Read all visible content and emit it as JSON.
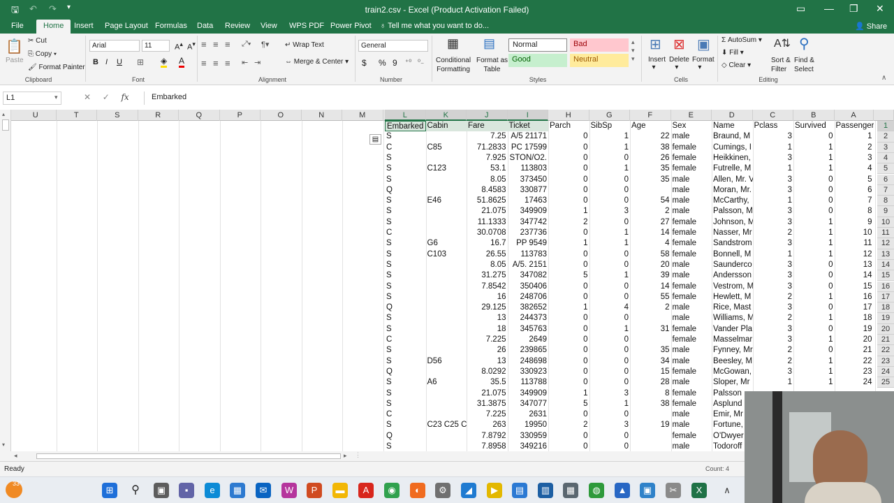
{
  "window": {
    "title": "train2.csv - Excel (Product Activation Failed)"
  },
  "ribbon_tabs": [
    "File",
    "Home",
    "Insert",
    "Page Layout",
    "Formulas",
    "Data",
    "Review",
    "View",
    "WPS PDF",
    "Power Pivot"
  ],
  "tell_me": "Tell me what you want to do...",
  "share": "Share",
  "clipboard": {
    "paste": "Paste",
    "cut": "Cut",
    "copy": "Copy",
    "format_painter": "Format Painter",
    "label": "Clipboard"
  },
  "font": {
    "name": "Arial",
    "size": "11",
    "label": "Font"
  },
  "alignment": {
    "wrap": "Wrap Text",
    "merge": "Merge & Center",
    "label": "Alignment"
  },
  "number": {
    "format": "General",
    "label": "Number",
    "currency": "$",
    "percent": "%",
    "comma": "9"
  },
  "styles": {
    "cond": "Conditional\nFormatting",
    "table": "Format as\nTable",
    "label": "Styles",
    "normal": "Normal",
    "bad": "Bad",
    "good": "Good",
    "neutral": "Neutral"
  },
  "cells": {
    "insert": "Insert",
    "delete": "Delete",
    "format": "Format",
    "label": "Cells"
  },
  "editing": {
    "autosum": "AutoSum",
    "fill": "Fill",
    "clear": "Clear",
    "sort": "Sort &\nFilter",
    "find": "Find &\nSelect",
    "label": "Editing"
  },
  "formula_bar": {
    "name_box": "L1",
    "fx": "fx",
    "content": "Embarked"
  },
  "columns_left": [
    "U",
    "T",
    "S",
    "R",
    "Q",
    "P",
    "O",
    "N",
    "M"
  ],
  "columns_data": [
    "L",
    "K",
    "J",
    "I",
    "H",
    "G",
    "F",
    "E",
    "D",
    "C",
    "B",
    "A"
  ],
  "headers": [
    "Embarked",
    "Cabin",
    "Fare",
    "Ticket",
    "Parch",
    "SibSp",
    "Age",
    "Sex",
    "Name",
    "Pclass",
    "Survived",
    "Passenger"
  ],
  "rows": [
    [
      "S",
      "",
      "7.25",
      "A/5 21171",
      "0",
      "1",
      "22",
      "male",
      "Braund, M",
      "3",
      "0",
      "1"
    ],
    [
      "C",
      "C85",
      "71.2833",
      "PC 17599",
      "0",
      "1",
      "38",
      "female",
      "Cumings, I",
      "1",
      "1",
      "2"
    ],
    [
      "S",
      "",
      "7.925",
      "STON/O2.",
      "0",
      "0",
      "26",
      "female",
      "Heikkinen,",
      "3",
      "1",
      "3"
    ],
    [
      "S",
      "C123",
      "53.1",
      "113803",
      "0",
      "1",
      "35",
      "female",
      "Futrelle, M",
      "1",
      "1",
      "4"
    ],
    [
      "S",
      "",
      "8.05",
      "373450",
      "0",
      "0",
      "35",
      "male",
      "Allen, Mr. V",
      "3",
      "0",
      "5"
    ],
    [
      "Q",
      "",
      "8.4583",
      "330877",
      "0",
      "0",
      "",
      "male",
      "Moran, Mr.",
      "3",
      "0",
      "6"
    ],
    [
      "S",
      "E46",
      "51.8625",
      "17463",
      "0",
      "0",
      "54",
      "male",
      "McCarthy,",
      "1",
      "0",
      "7"
    ],
    [
      "S",
      "",
      "21.075",
      "349909",
      "1",
      "3",
      "2",
      "male",
      "Palsson, M",
      "3",
      "0",
      "8"
    ],
    [
      "S",
      "",
      "11.1333",
      "347742",
      "2",
      "0",
      "27",
      "female",
      "Johnson, M",
      "3",
      "1",
      "9"
    ],
    [
      "C",
      "",
      "30.0708",
      "237736",
      "0",
      "1",
      "14",
      "female",
      "Nasser, Mr",
      "2",
      "1",
      "10"
    ],
    [
      "S",
      "G6",
      "16.7",
      "PP 9549",
      "1",
      "1",
      "4",
      "female",
      "Sandstrom",
      "3",
      "1",
      "11"
    ],
    [
      "S",
      "C103",
      "26.55",
      "113783",
      "0",
      "0",
      "58",
      "female",
      "Bonnell, M",
      "1",
      "1",
      "12"
    ],
    [
      "S",
      "",
      "8.05",
      "A/5. 2151",
      "0",
      "0",
      "20",
      "male",
      "Saunderco",
      "3",
      "0",
      "13"
    ],
    [
      "S",
      "",
      "31.275",
      "347082",
      "5",
      "1",
      "39",
      "male",
      "Andersson",
      "3",
      "0",
      "14"
    ],
    [
      "S",
      "",
      "7.8542",
      "350406",
      "0",
      "0",
      "14",
      "female",
      "Vestrom, M",
      "3",
      "0",
      "15"
    ],
    [
      "S",
      "",
      "16",
      "248706",
      "0",
      "0",
      "55",
      "female",
      "Hewlett, M",
      "2",
      "1",
      "16"
    ],
    [
      "Q",
      "",
      "29.125",
      "382652",
      "1",
      "4",
      "2",
      "male",
      "Rice, Mast",
      "3",
      "0",
      "17"
    ],
    [
      "S",
      "",
      "13",
      "244373",
      "0",
      "0",
      "",
      "male",
      "Williams, M",
      "2",
      "1",
      "18"
    ],
    [
      "S",
      "",
      "18",
      "345763",
      "0",
      "1",
      "31",
      "female",
      "Vander Pla",
      "3",
      "0",
      "19"
    ],
    [
      "C",
      "",
      "7.225",
      "2649",
      "0",
      "0",
      "",
      "female",
      "Masselmar",
      "3",
      "1",
      "20"
    ],
    [
      "S",
      "",
      "26",
      "239865",
      "0",
      "0",
      "35",
      "male",
      "Fynney, Mr",
      "2",
      "0",
      "21"
    ],
    [
      "S",
      "D56",
      "13",
      "248698",
      "0",
      "0",
      "34",
      "male",
      "Beesley, M",
      "2",
      "1",
      "22"
    ],
    [
      "Q",
      "",
      "8.0292",
      "330923",
      "0",
      "0",
      "15",
      "female",
      "McGowan,",
      "3",
      "1",
      "23"
    ],
    [
      "S",
      "A6",
      "35.5",
      "113788",
      "0",
      "0",
      "28",
      "male",
      "Sloper, Mr",
      "1",
      "1",
      "24"
    ],
    [
      "S",
      "",
      "21.075",
      "349909",
      "1",
      "3",
      "8",
      "female",
      "Palsson",
      "",
      "",
      ""
    ],
    [
      "S",
      "",
      "31.3875",
      "347077",
      "5",
      "1",
      "38",
      "female",
      "Asplund",
      "",
      "",
      ""
    ],
    [
      "C",
      "",
      "7.225",
      "2631",
      "0",
      "0",
      "",
      "male",
      "Emir, Mr",
      "",
      "",
      ""
    ],
    [
      "S",
      "C23 C25 C",
      "263",
      "19950",
      "2",
      "3",
      "19",
      "male",
      "Fortune,",
      "",
      "",
      ""
    ],
    [
      "Q",
      "",
      "7.8792",
      "330959",
      "0",
      "0",
      "",
      "female",
      "O'Dwyer",
      "",
      "",
      ""
    ],
    [
      "S",
      "",
      "7.8958",
      "349216",
      "0",
      "0",
      "",
      "male",
      "Todoroff",
      "",
      "",
      ""
    ]
  ],
  "row_numbers": [
    "1",
    "2",
    "3",
    "4",
    "5",
    "6",
    "7",
    "8",
    "9",
    "10",
    "11",
    "12",
    "13",
    "14",
    "15",
    "16",
    "17",
    "18",
    "19",
    "20",
    "21",
    "22",
    "23",
    "24",
    "25"
  ],
  "status": {
    "ready": "Ready",
    "count": "Count: 4"
  },
  "taskbar": {
    "weather": "33°"
  }
}
